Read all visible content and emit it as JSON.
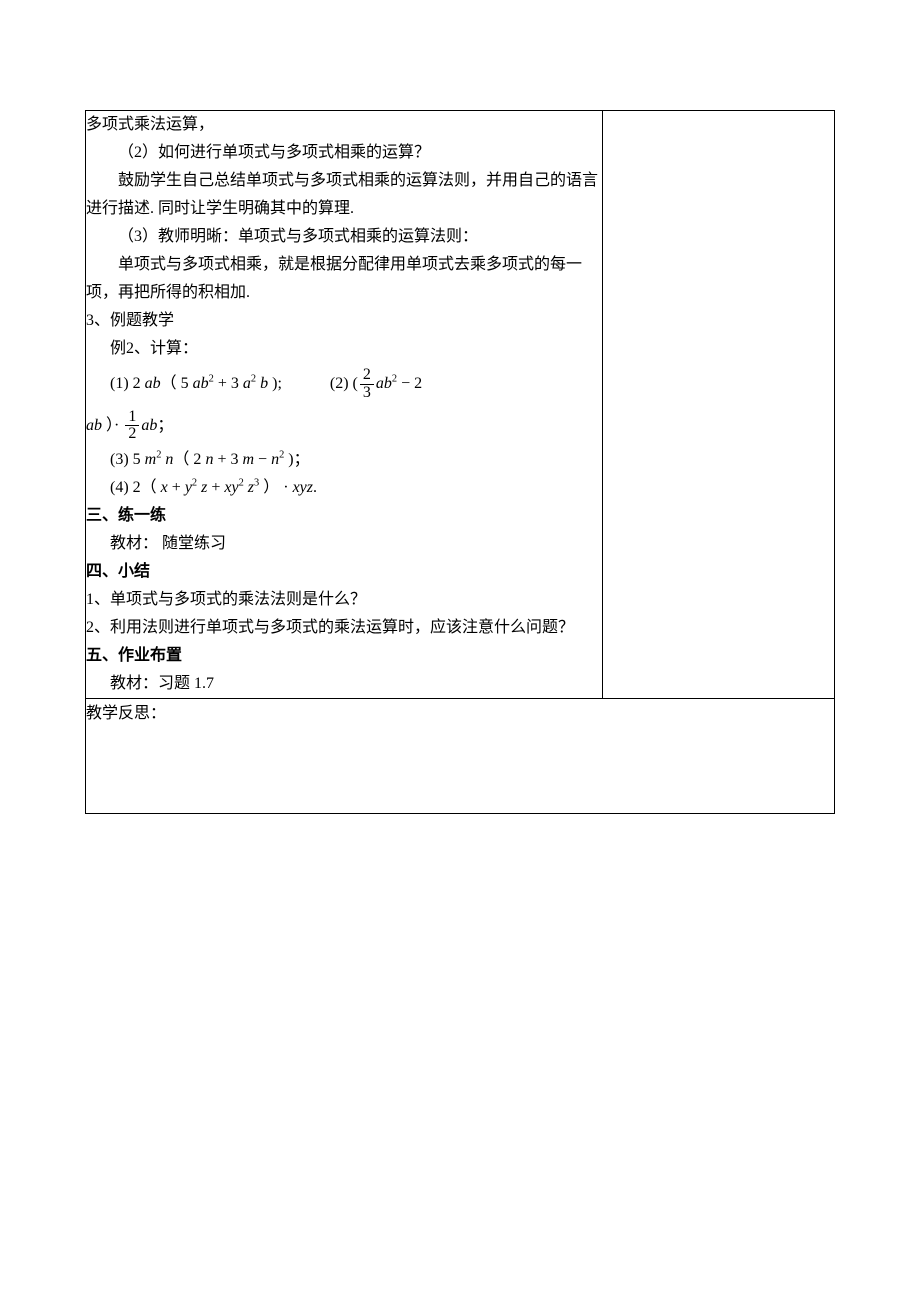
{
  "main": {
    "line01": "多项式乘法运算，",
    "q2": "（2）如何进行单项式与多项式相乘的运算？",
    "encourage": "鼓励学生自己总结单项式与多项式相乘的运算法则，并用自己的语言进行描述. 同时让学生明确其中的算理.",
    "q3": "（3）教师明晰：单项式与多项式相乘的运算法则：",
    "rule": "单项式与多项式相乘，就是根据分配律用单项式去乘多项式的每一项，再把所得的积相加.",
    "exSectionNum": "3、",
    "exSectionTitle": "例题教学",
    "ex2Label": "例2、计算：",
    "formula1_prefix": "(1) 2 ",
    "formula1_ab": "ab",
    "formula1_mid1": "（ 5 ",
    "formula1_ab2": "ab",
    "formula1_sup2": "2",
    "formula1_plus": " + 3 ",
    "formula1_a": "a",
    "formula1_asup": "2",
    "formula1_b": " b",
    "formula1_end": " );",
    "formula2_prefix": "(2) (",
    "formula2_frac_num": "2",
    "formula2_frac_den": "3",
    "formula2_ab": "ab",
    "formula2_sup": "2",
    "formula2_minus": " − 2",
    "formula2b_ab": "ab",
    "formula2b_dot": " ）· ",
    "formula2b_frac_num": "1",
    "formula2b_frac_den": "2",
    "formula2b_ab2": "ab",
    "formula2b_semi": "；",
    "formula3_prefix": "(3) 5 ",
    "formula3_m": "m",
    "formula3_msup": "2",
    "formula3_n": " n",
    "formula3_open": "（ 2 ",
    "formula3_n2": "n",
    "formula3_plus": " + 3 ",
    "formula3_m2": "m",
    "formula3_minus": " − ",
    "formula3_n3": "n",
    "formula3_nsup": "2",
    "formula3_end": " )；",
    "formula4_prefix": "(4) 2（ ",
    "formula4_x": "x",
    "formula4_p1": " + ",
    "formula4_y": "y",
    "formula4_ysup": "2",
    "formula4_z": " z",
    "formula4_p2": " + ",
    "formula4_xy": "xy",
    "formula4_xysup": "2",
    "formula4_z2": " z",
    "formula4_zsup": "3",
    "formula4_close": " ）  ·  ",
    "formula4_xyz": "xyz",
    "formula4_dot": ".",
    "sec3": "三、练一练",
    "sec3Body": "教材：   随堂练习",
    "sec4": "四、小结",
    "sec4_1": "1、单项式与多项式的乘法法则是什么？",
    "sec4_2": "2、利用法则进行单项式与多项式的乘法运算时，应该注意什么问题？",
    "sec5": "五、作业布置",
    "sec5Body": "教材：习题 1.7"
  },
  "reflect": "教学反思："
}
